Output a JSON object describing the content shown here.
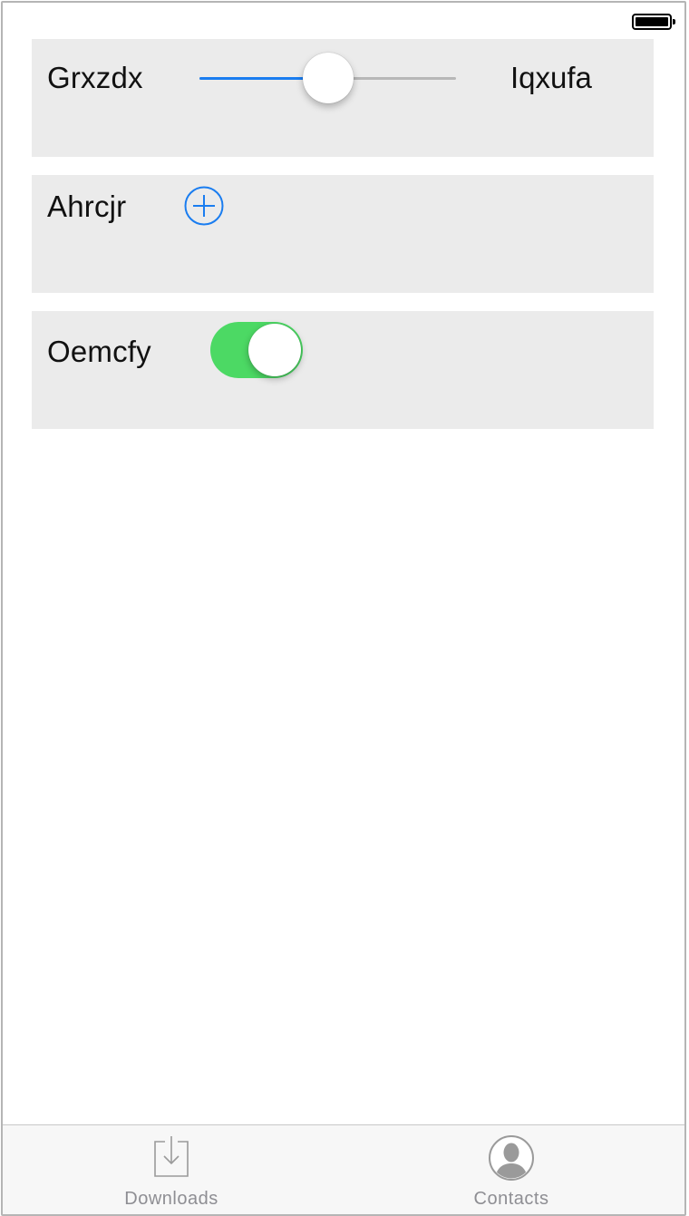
{
  "colors": {
    "accent": "#1a7df0",
    "toggle_on": "#4cd964",
    "card_bg": "#ebebeb",
    "tab_inactive": "#8e8e93"
  },
  "rows": {
    "slider": {
      "label": "Grxzdx",
      "right_label": "Iqxufa",
      "value_fraction": 0.5
    },
    "add": {
      "label": "Ahrcjr",
      "icon": "plus-circle-icon"
    },
    "toggle": {
      "label": "Oemcfy",
      "state": "on"
    }
  },
  "tab_bar": {
    "items": [
      {
        "label": "Downloads",
        "icon": "download-tray-icon"
      },
      {
        "label": "Contacts",
        "icon": "contact-person-icon"
      }
    ]
  }
}
